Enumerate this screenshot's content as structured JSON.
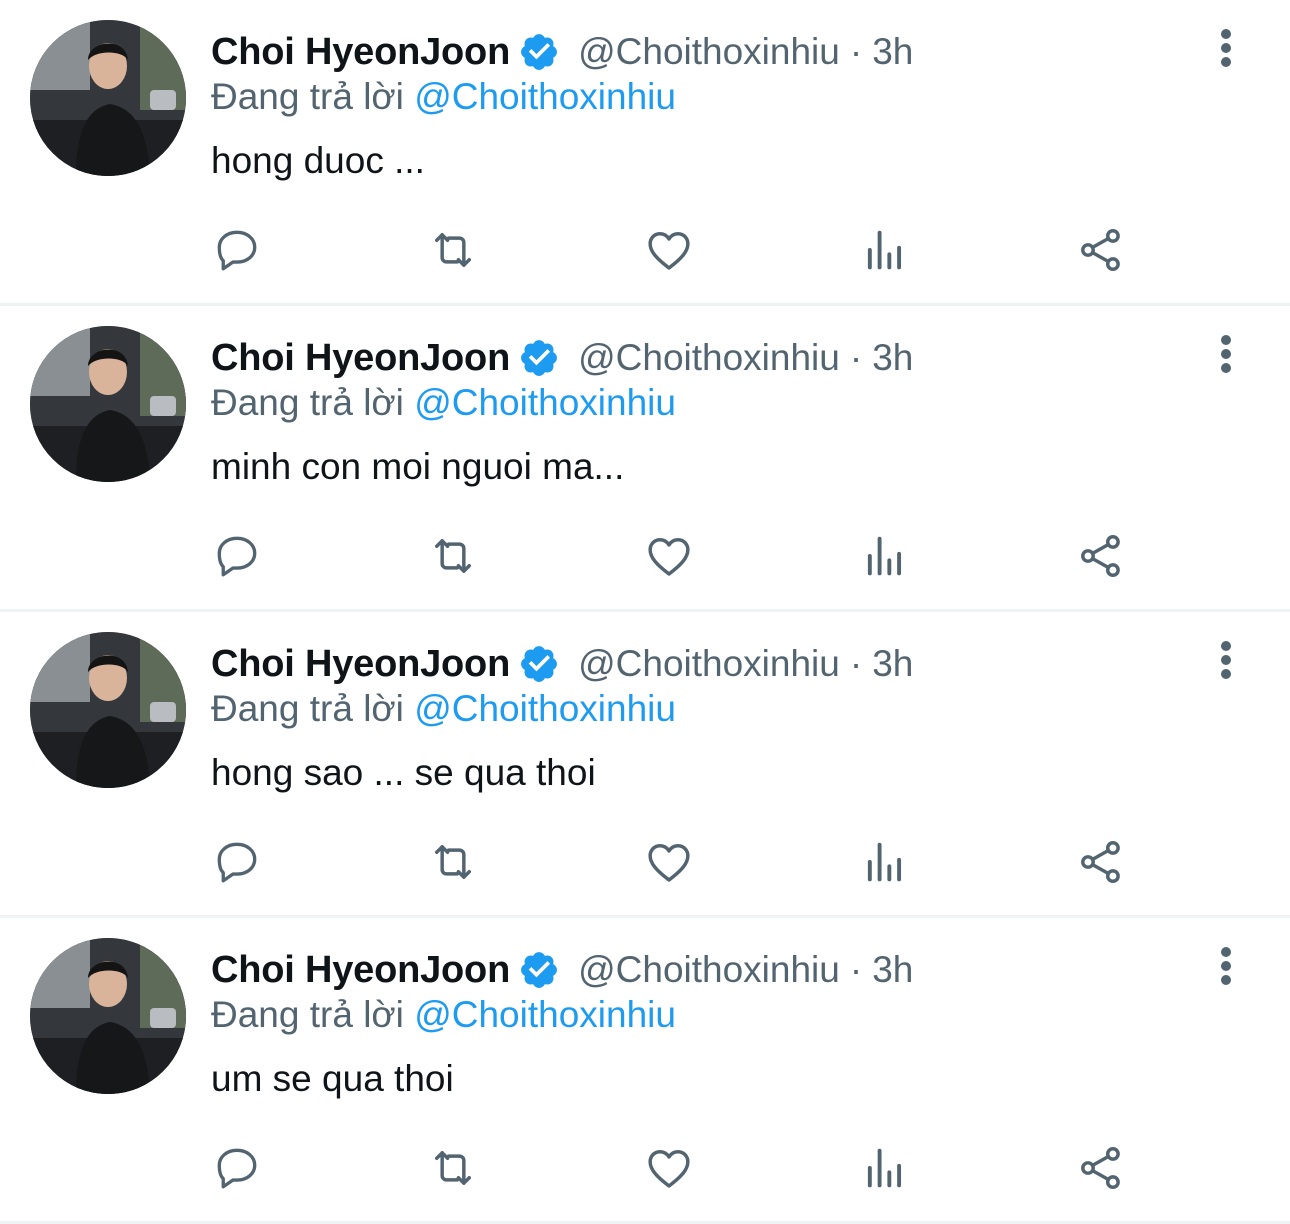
{
  "colors": {
    "accent": "#1d9bf0",
    "secondary_text": "#536471",
    "primary_text": "#0f1419",
    "icon": "#536471",
    "divider": "#eff3f4"
  },
  "icons": {
    "verified": "verified-badge-icon",
    "more": "more-vertical-icon",
    "reply": "reply-icon",
    "retweet": "retweet-icon",
    "like": "heart-icon",
    "views": "views-icon",
    "share": "share-icon"
  },
  "tweets": [
    {
      "author_name": "Choi HyeonJoon",
      "handle": "@Choithoxinhiu",
      "separator": "·",
      "time": "3h",
      "replying_prefix": "Đang trả lời",
      "replying_to": "@Choithoxinhiu",
      "text": "hong duoc ..."
    },
    {
      "author_name": "Choi HyeonJoon",
      "handle": "@Choithoxinhiu",
      "separator": "·",
      "time": "3h",
      "replying_prefix": "Đang trả lời",
      "replying_to": "@Choithoxinhiu",
      "text": "minh con moi nguoi ma..."
    },
    {
      "author_name": "Choi HyeonJoon",
      "handle": "@Choithoxinhiu",
      "separator": "·",
      "time": "3h",
      "replying_prefix": "Đang trả lời",
      "replying_to": "@Choithoxinhiu",
      "text": "hong sao ... se qua thoi"
    },
    {
      "author_name": "Choi HyeonJoon",
      "handle": "@Choithoxinhiu",
      "separator": "·",
      "time": "3h",
      "replying_prefix": "Đang trả lời",
      "replying_to": "@Choithoxinhiu",
      "text": "um se qua thoi"
    }
  ]
}
